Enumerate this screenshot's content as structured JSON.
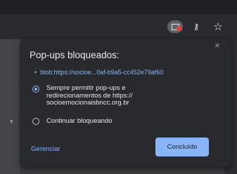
{
  "toolbar": {
    "icons": [
      "popup-blocked-icon",
      "key-icon",
      "star-icon"
    ]
  },
  "dialog": {
    "title": "Pop-ups bloqueados:",
    "close_icon": "close-icon",
    "blocked_url": "blob:https://socioe...0af-b9a5-cc452e79af60",
    "options": [
      {
        "lines": [
          "Sempre permitir pop-ups e",
          "redirecionamentos de https://",
          "socioemocionaisbncc.org.br"
        ],
        "selected": true
      },
      {
        "lines": [
          "Continuar bloqueando"
        ],
        "selected": false
      }
    ],
    "manage_label": "Gerenciar",
    "done_label": "Concluído"
  },
  "colors": {
    "accent": "#8ab4f8",
    "dialog_bg": "#292a2d",
    "text": "#e8eaed",
    "blocked_badge": "#ea4335"
  }
}
